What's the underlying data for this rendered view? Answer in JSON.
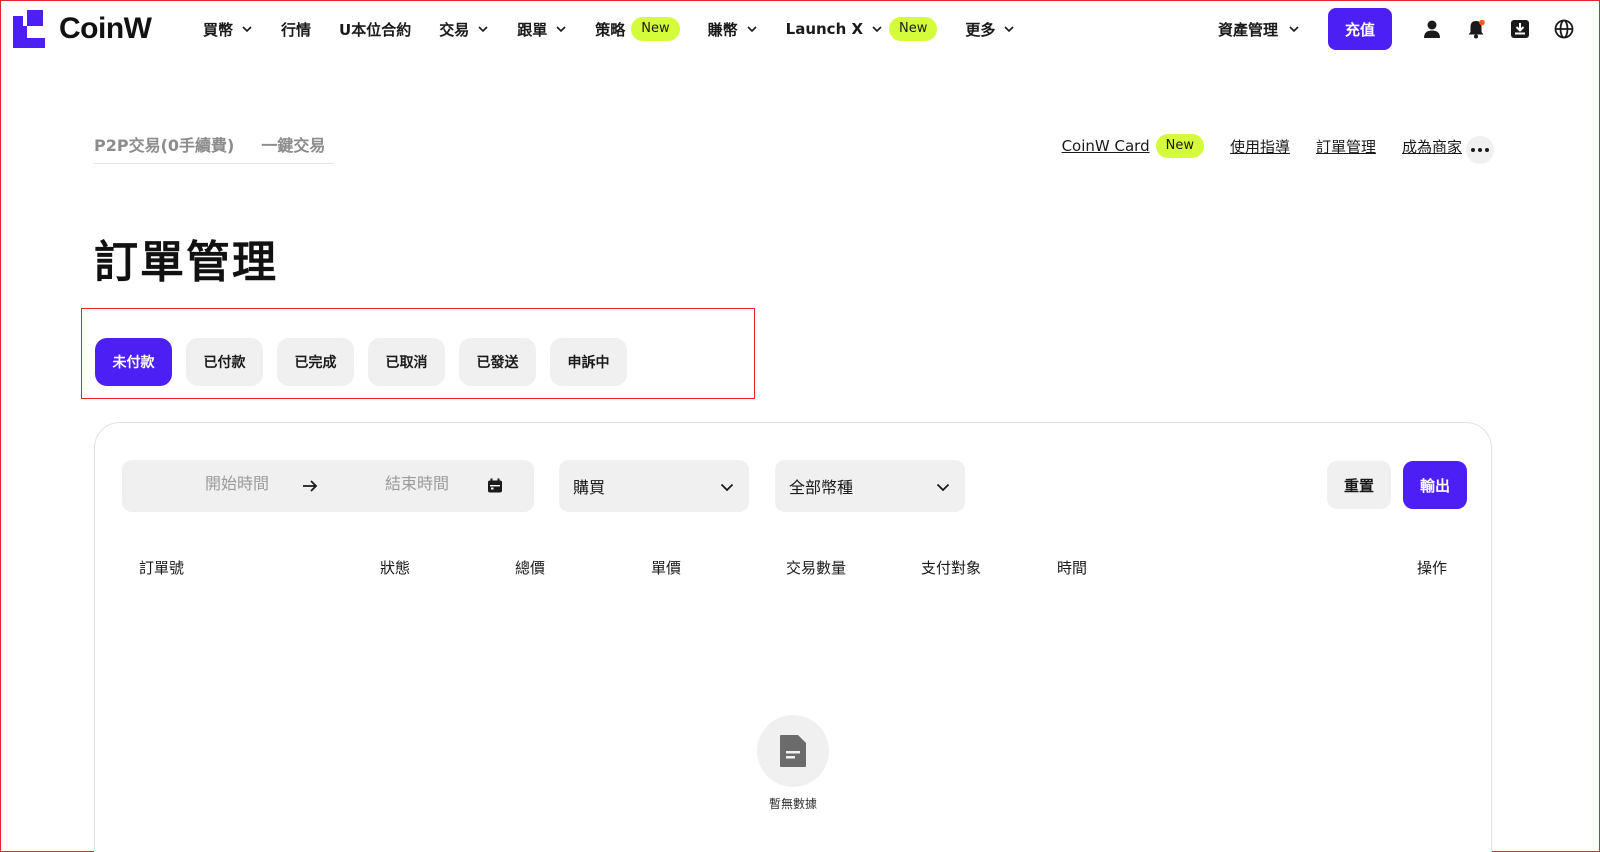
{
  "brand": {
    "name": "CoinW",
    "accent": "#4c1ff5",
    "badge_color": "#d4fc3a"
  },
  "topnav": {
    "items": [
      {
        "label": "買幣",
        "has_dropdown": true
      },
      {
        "label": "行情",
        "has_dropdown": false
      },
      {
        "label": "U本位合約",
        "has_dropdown": false
      },
      {
        "label": "交易",
        "has_dropdown": true
      },
      {
        "label": "跟單",
        "has_dropdown": true
      },
      {
        "label": "策略",
        "has_dropdown": false,
        "badge": "New"
      },
      {
        "label": "賺幣",
        "has_dropdown": true
      },
      {
        "label": "Launch X",
        "has_dropdown": true,
        "badge": "New"
      },
      {
        "label": "更多",
        "has_dropdown": true
      }
    ],
    "asset_management": "資產管理",
    "deposit": "充值",
    "icons": [
      "user-icon",
      "bell-icon",
      "download-icon",
      "globe-icon"
    ]
  },
  "subnav": {
    "tabs": [
      "P2P交易(0手續費)",
      "一鍵交易"
    ],
    "links": [
      {
        "label": "CoinW Card",
        "badge": "New"
      },
      {
        "label": "使用指導"
      },
      {
        "label": "訂單管理"
      },
      {
        "label": "成為商家"
      }
    ]
  },
  "page_title": "訂單管理",
  "status_tabs": [
    {
      "label": "未付款",
      "active": true
    },
    {
      "label": "已付款",
      "active": false
    },
    {
      "label": "已完成",
      "active": false
    },
    {
      "label": "已取消",
      "active": false
    },
    {
      "label": "已發送",
      "active": false
    },
    {
      "label": "申訴中",
      "active": false
    }
  ],
  "filters": {
    "start_placeholder": "開始時間",
    "end_placeholder": "結束時間",
    "side": "購買",
    "coin": "全部幣種",
    "reset": "重置",
    "export": "輸出"
  },
  "table": {
    "columns": [
      "訂單號",
      "狀態",
      "總價",
      "單價",
      "交易數量",
      "支付對象",
      "時間",
      "操作"
    ]
  },
  "empty_state": "暫無數據"
}
